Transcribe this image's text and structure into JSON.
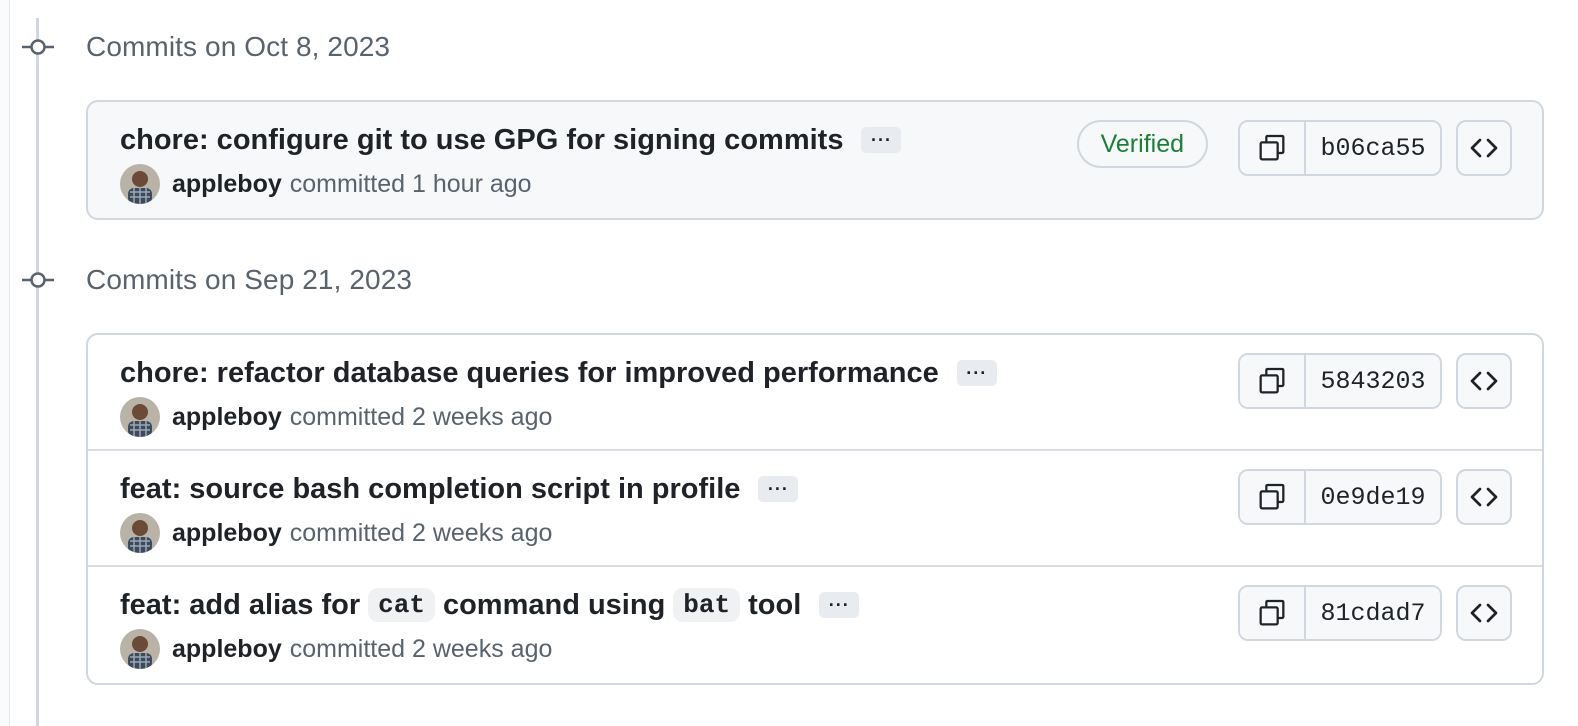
{
  "groups": [
    {
      "title": "Commits on Oct 8, 2023",
      "commits": [
        {
          "title": "chore: configure git to use GPG for signing commits",
          "author": "appleboy",
          "meta": "committed 1 hour ago",
          "verified": "Verified",
          "sha": "b06ca55",
          "ellipsis": "···"
        }
      ]
    },
    {
      "title": "Commits on Sep 21, 2023",
      "commits": [
        {
          "title": "chore: refactor database queries for improved performance",
          "author": "appleboy",
          "meta": "committed 2 weeks ago",
          "sha": "5843203",
          "ellipsis": "···"
        },
        {
          "title": "feat: source bash completion script in profile",
          "author": "appleboy",
          "meta": "committed 2 weeks ago",
          "sha": "0e9de19",
          "ellipsis": "···"
        },
        {
          "title_parts": [
            "feat: add alias for",
            "cat",
            "command using",
            "bat",
            "tool"
          ],
          "author": "appleboy",
          "meta": "committed 2 weeks ago",
          "sha": "81cdad7",
          "ellipsis": "···"
        }
      ]
    }
  ],
  "icons": {
    "commit_node": "git-commit-icon",
    "copy": "copy-icon",
    "browse": "code-icon",
    "more": "ellipsis-icon"
  },
  "colors": {
    "verified": "#1a7f37",
    "muted_text": "#59636e",
    "border": "#d0d7de",
    "highlight_bg": "#f6f8fa"
  }
}
